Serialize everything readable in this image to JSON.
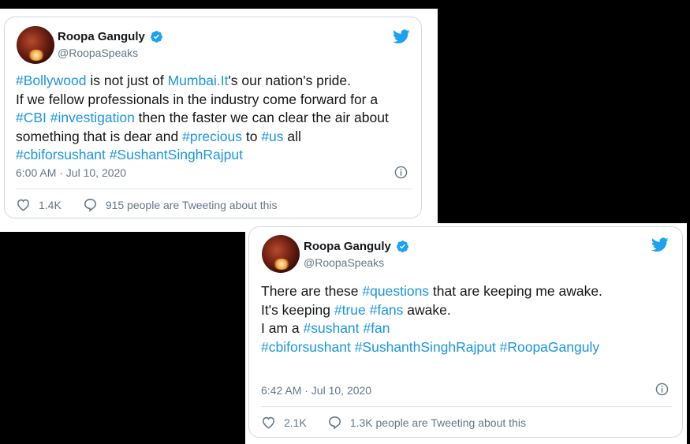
{
  "tweets": [
    {
      "name": "Roopa Ganguly",
      "handle": "@RoopaSpeaks",
      "lines": [
        [
          {
            "t": "#Bollywood",
            "h": true
          },
          {
            "t": " is not just of ",
            "h": false
          },
          {
            "t": "Mumbai.It",
            "h": true
          },
          {
            "t": "'s our nation's pride.",
            "h": false
          }
        ],
        [
          {
            "t": "If we fellow professionals in the industry come forward for a",
            "h": false
          }
        ],
        [
          {
            "t": "#CBI",
            "h": true
          },
          {
            "t": " ",
            "h": false
          },
          {
            "t": "#investigation",
            "h": true
          },
          {
            "t": " then the faster we can clear the air about",
            "h": false
          }
        ],
        [
          {
            "t": "something that is dear and ",
            "h": false
          },
          {
            "t": "#precious",
            "h": true
          },
          {
            "t": " to ",
            "h": false
          },
          {
            "t": "#us",
            "h": true
          },
          {
            "t": " all",
            "h": false
          }
        ],
        [
          {
            "t": "#cbiforsushant",
            "h": true
          },
          {
            "t": " ",
            "h": false
          },
          {
            "t": "#SushantSinghRajput",
            "h": true
          }
        ]
      ],
      "timestamp": "6:00 AM · Jul 10, 2020",
      "likes": "1.4K",
      "conversation": "915 people are Tweeting about this"
    },
    {
      "name": "Roopa Ganguly",
      "handle": "@RoopaSpeaks",
      "lines": [
        [
          {
            "t": "There are these ",
            "h": false
          },
          {
            "t": "#questions",
            "h": true
          },
          {
            "t": " that are keeping me awake.",
            "h": false
          }
        ],
        [
          {
            "t": "It's keeping ",
            "h": false
          },
          {
            "t": "#true",
            "h": true
          },
          {
            "t": " ",
            "h": false
          },
          {
            "t": "#fans",
            "h": true
          },
          {
            "t": " awake.",
            "h": false
          }
        ],
        [
          {
            "t": "I am a ",
            "h": false
          },
          {
            "t": "#sushant",
            "h": true
          },
          {
            "t": " ",
            "h": false
          },
          {
            "t": "#fan",
            "h": true
          }
        ],
        [
          {
            "t": " ",
            "h": false
          }
        ],
        [
          {
            "t": "#cbiforsushant",
            "h": true
          },
          {
            "t": " ",
            "h": false
          },
          {
            "t": "#SushanthSinghRajput",
            "h": true
          },
          {
            "t": " ",
            "h": false
          },
          {
            "t": "#RoopaGanguly",
            "h": true
          }
        ]
      ],
      "timestamp": "6:42 AM · Jul 10, 2020",
      "likes": "2.1K",
      "conversation": "1.3K people are Tweeting about this"
    }
  ],
  "icons": {
    "brand_color": "#1da1f2",
    "hashtag_color": "#1b95e0",
    "names": [
      "twitter-bird-icon",
      "verified-badge-icon",
      "info-icon",
      "heart-icon",
      "conversation-icon"
    ]
  }
}
